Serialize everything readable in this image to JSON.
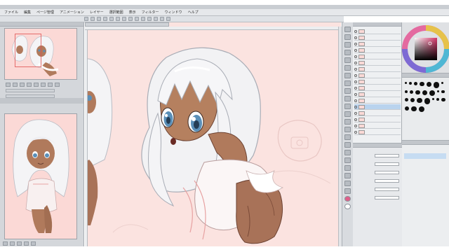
{
  "window": {
    "title": "",
    "menus": [
      "ファイル",
      "編集",
      "ページ管理",
      "アニメーション",
      "レイヤー",
      "選択範囲",
      "表示",
      "フィルター",
      "ウィンドウ",
      "ヘルプ"
    ]
  },
  "navigator": {
    "zoom_label": ""
  },
  "canvas": {
    "tab_label": ""
  },
  "layers": {
    "rows": [
      "",
      "",
      "",
      "",
      "",
      "",
      "",
      "",
      "",
      "",
      "",
      "",
      "",
      "",
      "",
      "",
      ""
    ],
    "selected_index": 12
  },
  "tool_property": {
    "rows": [
      "",
      "",
      "",
      "",
      "",
      ""
    ]
  },
  "sub_tools": {
    "items": [
      "",
      "",
      "",
      "",
      "",
      "",
      "",
      "",
      "",
      "",
      "",
      "",
      "",
      "",
      ""
    ],
    "selected_index": 1
  },
  "colors": {
    "background_skin": "#fbe3e0",
    "panel": "#e3e5e8",
    "selection": "#b9d3ee",
    "hair": "#f4f4f6",
    "hair_shadow": "#b9bcc4",
    "skin_tan": "#b07a5c",
    "eye_blue": "#5a8fb8",
    "brush_black": "#101010"
  }
}
